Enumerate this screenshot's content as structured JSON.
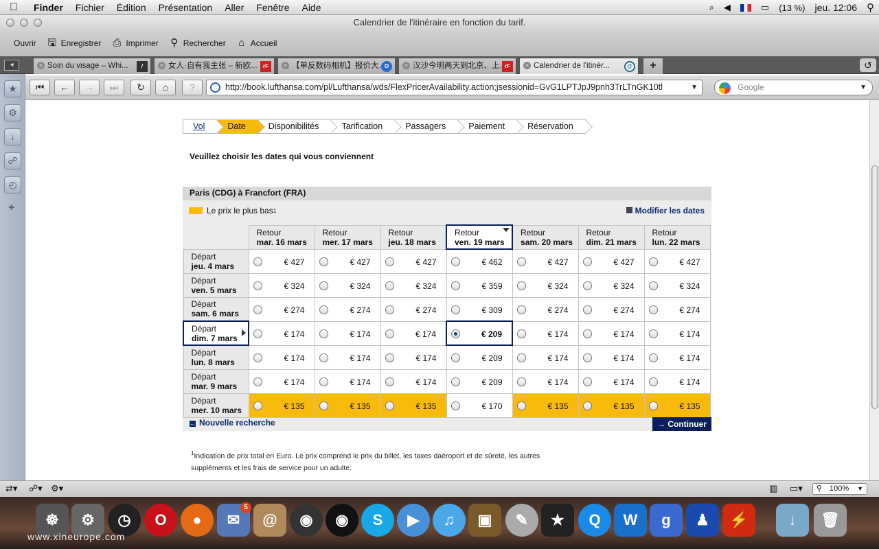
{
  "menubar": {
    "app": "Finder",
    "items": [
      "Fichier",
      "Édition",
      "Présentation",
      "Aller",
      "Fenêtre",
      "Aide"
    ],
    "battery": "(13 %)",
    "clock": "jeu. 12:06"
  },
  "window": {
    "title": "Calendrier de l'itinéraire en fonction du tarif."
  },
  "toolbar": {
    "open": "Ouvrir",
    "save": "Enregistrer",
    "print": "Imprimer",
    "search": "Rechercher",
    "home": "Accueil"
  },
  "tabs": [
    {
      "label": "Soin du visage – Whi..."
    },
    {
      "label": "女人·自有我主张 – 新欧..."
    },
    {
      "label": "【单反数码相机】报价大..."
    },
    {
      "label": "汉沙今明两天到北京、上..."
    },
    {
      "label": "Calendrier de l'itinér..."
    }
  ],
  "nav": {
    "url": "http://book.lufthansa.com/pl/Lufthansa/wds/FlexPricerAvailability.action;jsessionid=GvG1LPTJpJ9pnh3TrLTnGK10tl",
    "search_placeholder": "Google"
  },
  "steps": [
    "Vol",
    "Date",
    "Disponibilités",
    "Tarification",
    "Passagers",
    "Paiement",
    "Réservation"
  ],
  "intro": "Veuillez choisir les dates qui vous conviennent",
  "route": "Paris (CDG) à Francfort (FRA)",
  "legend": {
    "label": "Le prix le plus bas",
    "note": "1",
    "color": "#f8ba0c"
  },
  "modify_dates": "Modifier les dates",
  "return_label": "Retour",
  "depart_label": "Départ",
  "returns": [
    "mar. 16 mars",
    "mer. 17 mars",
    "jeu. 18 mars",
    "ven. 19 mars",
    "sam. 20 mars",
    "dim. 21 mars",
    "lun. 22 mars"
  ],
  "departs": [
    "jeu. 4 mars",
    "ven. 5 mars",
    "sam. 6 mars",
    "dim. 7 mars",
    "lun. 8 mars",
    "mar. 9 mars",
    "mer. 10 mars"
  ],
  "prices": [
    [
      "€ 427",
      "€ 427",
      "€ 427",
      "€ 462",
      "€ 427",
      "€ 427",
      "€ 427"
    ],
    [
      "€ 324",
      "€ 324",
      "€ 324",
      "€ 359",
      "€ 324",
      "€ 324",
      "€ 324"
    ],
    [
      "€ 274",
      "€ 274",
      "€ 274",
      "€ 309",
      "€ 274",
      "€ 274",
      "€ 274"
    ],
    [
      "€ 174",
      "€ 174",
      "€ 174",
      "€ 209",
      "€ 174",
      "€ 174",
      "€ 174"
    ],
    [
      "€ 174",
      "€ 174",
      "€ 174",
      "€ 209",
      "€ 174",
      "€ 174",
      "€ 174"
    ],
    [
      "€ 174",
      "€ 174",
      "€ 174",
      "€ 209",
      "€ 174",
      "€ 174",
      "€ 174"
    ],
    [
      "€ 135",
      "€ 135",
      "€ 135",
      "€ 170",
      "€ 135",
      "€ 135",
      "€ 135"
    ]
  ],
  "selected": {
    "row": 3,
    "col": 3
  },
  "lowest_row": 6,
  "lowest_cols": [
    0,
    1,
    2,
    4,
    5,
    6
  ],
  "new_search": "Nouvelle recherche",
  "continue": "Continuer",
  "footnote": {
    "mark": "1",
    "line1": "Indication de prix total en Euro. Le prix comprend le prix du billet, les taxes daéroport et de sûreté, les autres",
    "line2": "suppléments et les frais de service pour un adulte."
  },
  "statusbar": {
    "zoom": "100%"
  },
  "dock": {
    "mail_badge": "5",
    "watermark": "www.xineurope.com"
  }
}
